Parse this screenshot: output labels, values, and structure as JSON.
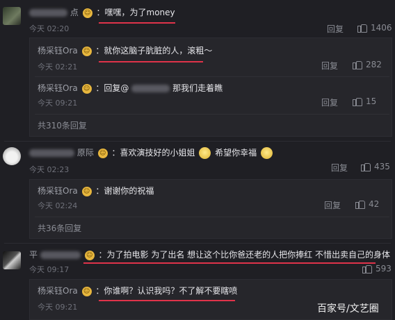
{
  "comments": [
    {
      "text": "：嘿嘿，为了money",
      "time": "今天 02:20",
      "reply": "回复",
      "likes": "1406",
      "name_suffix": "点",
      "replies": [
        {
          "name": "杨采钰Ora",
          "text": "：就你这脑子肮脏的人，滚粗～",
          "time": "今天 02:21",
          "reply": "回复",
          "likes": "282"
        },
        {
          "name": "杨采钰Ora",
          "text_prefix": "：回复@",
          "text_suffix": "那我们走着瞧",
          "time": "今天 09:21",
          "reply": "回复",
          "likes": "15"
        }
      ],
      "more": "共310条回复"
    },
    {
      "name_suffix": "原际",
      "text_a": "：喜欢演技好的小姐姐",
      "text_b": "希望你幸福",
      "time": "今天 02:23",
      "reply": "回复",
      "likes": "435",
      "replies": [
        {
          "name": "杨采钰Ora",
          "text": "：谢谢你的祝福",
          "time": "今天 02:24",
          "reply": "回复",
          "likes": "42"
        }
      ],
      "more": "共36条回复"
    },
    {
      "name_prefix": "平",
      "text": "：为了拍电影 为了出名 想让这个比你爸还老的人把你捧红 不惜出卖自己的身体",
      "time": "今天 09:17",
      "likes": "593",
      "replies": [
        {
          "name": "杨采钰Ora",
          "text": "：你谁啊？认识我吗？不了解不要瞎喷",
          "time": "今天 09:21"
        }
      ]
    }
  ],
  "watermark": "百家号/文艺圈",
  "colors": {
    "background": "#1f1f24",
    "underline": "#e0334a"
  }
}
